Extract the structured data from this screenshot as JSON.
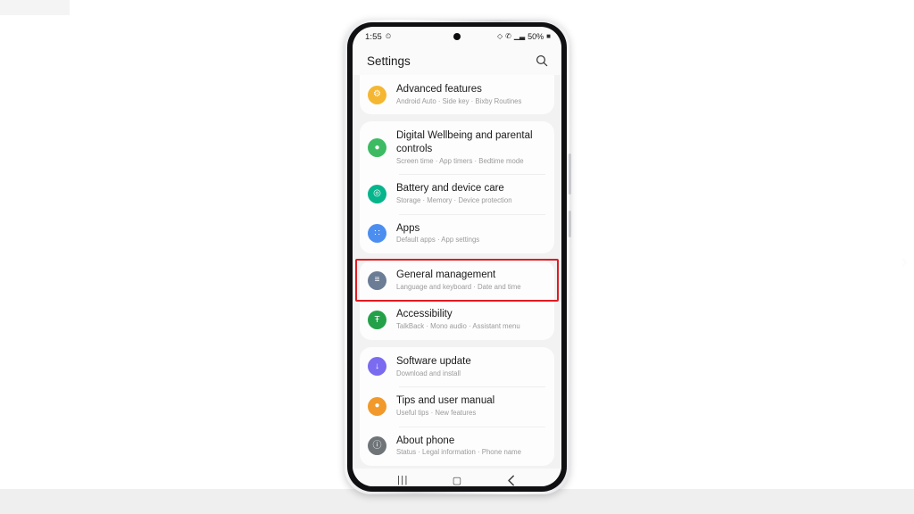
{
  "phone": {
    "status_bar": {
      "time": "1:55",
      "alarm_icon": "alarm-off-icon",
      "wifi_icon": "wifi-icon",
      "call_icon": "call-icon",
      "signal_icon": "signal-bars-icon",
      "battery_percent": "50%",
      "battery_icon": "battery-icon"
    },
    "app_bar": {
      "title": "Settings",
      "search_icon": "search-icon"
    },
    "nav_bar": {
      "recents_label": "|||",
      "home_label": "▢",
      "back_label": "‹",
      "recents_icon": "recents-icon",
      "home_icon": "home-icon",
      "back_icon": "back-icon"
    }
  },
  "settings": {
    "groups": [
      {
        "rows": [
          {
            "title": "Advanced features",
            "subtitle": "Android Auto  ·  Side key  ·  Bixby Routines",
            "icon": "advanced-features-icon",
            "icon_color": "#f5b731",
            "glyph": "⚙"
          }
        ]
      },
      {
        "rows": [
          {
            "title": "Digital Wellbeing and parental controls",
            "subtitle": "Screen time  ·  App timers  ·  Bedtime mode",
            "icon": "digital-wellbeing-icon",
            "icon_color": "#3dbb63",
            "glyph": "●"
          },
          {
            "title": "Battery and device care",
            "subtitle": "Storage  ·  Memory  ·  Device protection",
            "icon": "battery-device-care-icon",
            "icon_color": "#06b58c",
            "glyph": "◎"
          },
          {
            "title": "Apps",
            "subtitle": "Default apps  ·  App settings",
            "icon": "apps-icon",
            "icon_color": "#4b8ef0",
            "glyph": "∷"
          }
        ]
      },
      {
        "rows": [
          {
            "title": "General management",
            "subtitle": "Language and keyboard  ·  Date and time",
            "icon": "general-management-icon",
            "icon_color": "#6b7c95",
            "glyph": "≡"
          },
          {
            "title": "Accessibility",
            "subtitle": "TalkBack  ·  Mono audio  ·  Assistant menu",
            "icon": "accessibility-icon",
            "icon_color": "#24a148",
            "glyph": "Ŧ"
          }
        ]
      },
      {
        "rows": [
          {
            "title": "Software update",
            "subtitle": "Download and install",
            "icon": "software-update-icon",
            "icon_color": "#7b6bf0",
            "glyph": "↓"
          },
          {
            "title": "Tips and user manual",
            "subtitle": "Useful tips  ·  New features",
            "icon": "tips-icon",
            "icon_color": "#f1992b",
            "glyph": "●"
          },
          {
            "title": "About phone",
            "subtitle": "Status  ·  Legal information  ·  Phone name",
            "icon": "about-phone-icon",
            "icon_color": "#6f7478",
            "glyph": "ⓘ"
          }
        ]
      }
    ]
  },
  "annotation": {
    "highlight_color": "#e01b22",
    "highlight_target": "General management"
  },
  "carousel": {
    "next_label": "›",
    "next_icon": "chevron-right-icon"
  }
}
